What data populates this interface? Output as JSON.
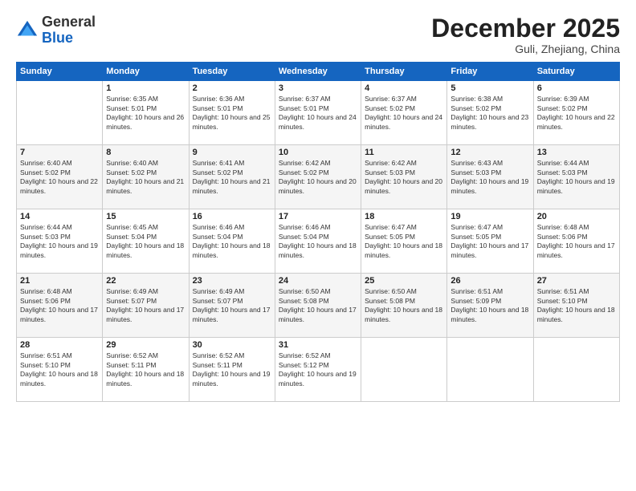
{
  "header": {
    "logo_general": "General",
    "logo_blue": "Blue",
    "month_title": "December 2025",
    "location": "Guli, Zhejiang, China"
  },
  "days_of_week": [
    "Sunday",
    "Monday",
    "Tuesday",
    "Wednesday",
    "Thursday",
    "Friday",
    "Saturday"
  ],
  "weeks": [
    [
      {
        "day": "",
        "sunrise": "",
        "sunset": "",
        "daylight": ""
      },
      {
        "day": "1",
        "sunrise": "Sunrise: 6:35 AM",
        "sunset": "Sunset: 5:01 PM",
        "daylight": "Daylight: 10 hours and 26 minutes."
      },
      {
        "day": "2",
        "sunrise": "Sunrise: 6:36 AM",
        "sunset": "Sunset: 5:01 PM",
        "daylight": "Daylight: 10 hours and 25 minutes."
      },
      {
        "day": "3",
        "sunrise": "Sunrise: 6:37 AM",
        "sunset": "Sunset: 5:01 PM",
        "daylight": "Daylight: 10 hours and 24 minutes."
      },
      {
        "day": "4",
        "sunrise": "Sunrise: 6:37 AM",
        "sunset": "Sunset: 5:02 PM",
        "daylight": "Daylight: 10 hours and 24 minutes."
      },
      {
        "day": "5",
        "sunrise": "Sunrise: 6:38 AM",
        "sunset": "Sunset: 5:02 PM",
        "daylight": "Daylight: 10 hours and 23 minutes."
      },
      {
        "day": "6",
        "sunrise": "Sunrise: 6:39 AM",
        "sunset": "Sunset: 5:02 PM",
        "daylight": "Daylight: 10 hours and 22 minutes."
      }
    ],
    [
      {
        "day": "7",
        "sunrise": "Sunrise: 6:40 AM",
        "sunset": "Sunset: 5:02 PM",
        "daylight": "Daylight: 10 hours and 22 minutes."
      },
      {
        "day": "8",
        "sunrise": "Sunrise: 6:40 AM",
        "sunset": "Sunset: 5:02 PM",
        "daylight": "Daylight: 10 hours and 21 minutes."
      },
      {
        "day": "9",
        "sunrise": "Sunrise: 6:41 AM",
        "sunset": "Sunset: 5:02 PM",
        "daylight": "Daylight: 10 hours and 21 minutes."
      },
      {
        "day": "10",
        "sunrise": "Sunrise: 6:42 AM",
        "sunset": "Sunset: 5:02 PM",
        "daylight": "Daylight: 10 hours and 20 minutes."
      },
      {
        "day": "11",
        "sunrise": "Sunrise: 6:42 AM",
        "sunset": "Sunset: 5:03 PM",
        "daylight": "Daylight: 10 hours and 20 minutes."
      },
      {
        "day": "12",
        "sunrise": "Sunrise: 6:43 AM",
        "sunset": "Sunset: 5:03 PM",
        "daylight": "Daylight: 10 hours and 19 minutes."
      },
      {
        "day": "13",
        "sunrise": "Sunrise: 6:44 AM",
        "sunset": "Sunset: 5:03 PM",
        "daylight": "Daylight: 10 hours and 19 minutes."
      }
    ],
    [
      {
        "day": "14",
        "sunrise": "Sunrise: 6:44 AM",
        "sunset": "Sunset: 5:03 PM",
        "daylight": "Daylight: 10 hours and 19 minutes."
      },
      {
        "day": "15",
        "sunrise": "Sunrise: 6:45 AM",
        "sunset": "Sunset: 5:04 PM",
        "daylight": "Daylight: 10 hours and 18 minutes."
      },
      {
        "day": "16",
        "sunrise": "Sunrise: 6:46 AM",
        "sunset": "Sunset: 5:04 PM",
        "daylight": "Daylight: 10 hours and 18 minutes."
      },
      {
        "day": "17",
        "sunrise": "Sunrise: 6:46 AM",
        "sunset": "Sunset: 5:04 PM",
        "daylight": "Daylight: 10 hours and 18 minutes."
      },
      {
        "day": "18",
        "sunrise": "Sunrise: 6:47 AM",
        "sunset": "Sunset: 5:05 PM",
        "daylight": "Daylight: 10 hours and 18 minutes."
      },
      {
        "day": "19",
        "sunrise": "Sunrise: 6:47 AM",
        "sunset": "Sunset: 5:05 PM",
        "daylight": "Daylight: 10 hours and 17 minutes."
      },
      {
        "day": "20",
        "sunrise": "Sunrise: 6:48 AM",
        "sunset": "Sunset: 5:06 PM",
        "daylight": "Daylight: 10 hours and 17 minutes."
      }
    ],
    [
      {
        "day": "21",
        "sunrise": "Sunrise: 6:48 AM",
        "sunset": "Sunset: 5:06 PM",
        "daylight": "Daylight: 10 hours and 17 minutes."
      },
      {
        "day": "22",
        "sunrise": "Sunrise: 6:49 AM",
        "sunset": "Sunset: 5:07 PM",
        "daylight": "Daylight: 10 hours and 17 minutes."
      },
      {
        "day": "23",
        "sunrise": "Sunrise: 6:49 AM",
        "sunset": "Sunset: 5:07 PM",
        "daylight": "Daylight: 10 hours and 17 minutes."
      },
      {
        "day": "24",
        "sunrise": "Sunrise: 6:50 AM",
        "sunset": "Sunset: 5:08 PM",
        "daylight": "Daylight: 10 hours and 17 minutes."
      },
      {
        "day": "25",
        "sunrise": "Sunrise: 6:50 AM",
        "sunset": "Sunset: 5:08 PM",
        "daylight": "Daylight: 10 hours and 18 minutes."
      },
      {
        "day": "26",
        "sunrise": "Sunrise: 6:51 AM",
        "sunset": "Sunset: 5:09 PM",
        "daylight": "Daylight: 10 hours and 18 minutes."
      },
      {
        "day": "27",
        "sunrise": "Sunrise: 6:51 AM",
        "sunset": "Sunset: 5:10 PM",
        "daylight": "Daylight: 10 hours and 18 minutes."
      }
    ],
    [
      {
        "day": "28",
        "sunrise": "Sunrise: 6:51 AM",
        "sunset": "Sunset: 5:10 PM",
        "daylight": "Daylight: 10 hours and 18 minutes."
      },
      {
        "day": "29",
        "sunrise": "Sunrise: 6:52 AM",
        "sunset": "Sunset: 5:11 PM",
        "daylight": "Daylight: 10 hours and 18 minutes."
      },
      {
        "day": "30",
        "sunrise": "Sunrise: 6:52 AM",
        "sunset": "Sunset: 5:11 PM",
        "daylight": "Daylight: 10 hours and 19 minutes."
      },
      {
        "day": "31",
        "sunrise": "Sunrise: 6:52 AM",
        "sunset": "Sunset: 5:12 PM",
        "daylight": "Daylight: 10 hours and 19 minutes."
      },
      {
        "day": "",
        "sunrise": "",
        "sunset": "",
        "daylight": ""
      },
      {
        "day": "",
        "sunrise": "",
        "sunset": "",
        "daylight": ""
      },
      {
        "day": "",
        "sunrise": "",
        "sunset": "",
        "daylight": ""
      }
    ]
  ]
}
